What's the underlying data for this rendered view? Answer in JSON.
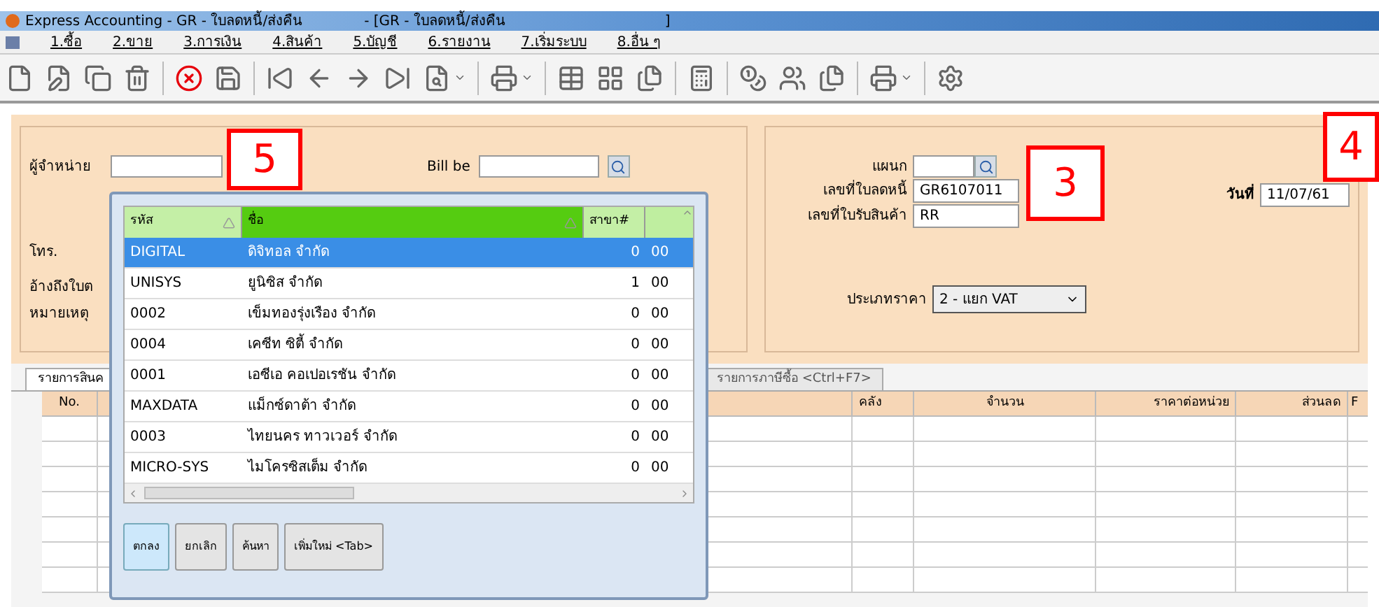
{
  "window": {
    "title": "Express Accounting - GR - ใบลดหนี้/ส่งคืน",
    "subtitle": "- [GR - ใบลดหนี้/ส่งคืน",
    "title_end": "]"
  },
  "menu": [
    "1.ซื้อ",
    "2.ขาย",
    "3.การเงิน",
    "4.สินค้า",
    "5.บัญชี",
    "6.รายงาน",
    "7.เริ่มระบบ",
    "8.อื่น ๆ"
  ],
  "form": {
    "supplier_label": "ผู้จำหน่าย",
    "bill_label": "Bill be",
    "phone_label": "โทร.",
    "reference_label": "อ้างถึงใบต",
    "note_label": "หมายเหตุ",
    "department_label": "แผนก",
    "credit_note_label": "เลขที่ใบลดหนี้",
    "credit_note_value": "GR6107011",
    "receipt_label": "เลขที่ใบรับสินค้า",
    "receipt_value": "RR",
    "date_label": "วันที่",
    "date_value": "11/07/61",
    "price_type_label": "ประเภทราคา",
    "price_type_value": "2 - แยก VAT"
  },
  "tabs": [
    {
      "label": "รายการสินค",
      "selected": true
    },
    {
      "label": "รายการภาษีซื้อ <Ctrl+F7>",
      "selected": false
    }
  ],
  "table": {
    "columns": [
      "No.",
      "คลัง",
      "จำนวน",
      "ราคาต่อหน่วย",
      "ส่วนลด",
      "F"
    ]
  },
  "supplier_popup": {
    "columns": [
      {
        "label": "รหัส",
        "sorted": false
      },
      {
        "label": "ชื่อ",
        "sorted": true
      },
      {
        "label": "สาขา#",
        "sorted": false
      }
    ],
    "rows": [
      {
        "code": "DIGITAL",
        "name": "ดิจิทอล จำกัด",
        "branch": "0",
        "column_4": "00",
        "selected": true
      },
      {
        "code": "UNISYS",
        "name": "ยูนิซิส จำกัด",
        "branch": "1",
        "column_4": "00",
        "selected": false
      },
      {
        "code": "0002",
        "name": "เข็มทองรุ่งเรือง จำกัด",
        "branch": "0",
        "column_4": "00",
        "selected": false
      },
      {
        "code": "0004",
        "name": "เคซีท ซิตี้ จำกัด",
        "branch": "0",
        "column_4": "00",
        "selected": false
      },
      {
        "code": "0001",
        "name": "เอซีเอ คอเปอเรชัน จำกัด",
        "branch": "0",
        "column_4": "00",
        "selected": false
      },
      {
        "code": "MAXDATA",
        "name": "แม็กซ์ดาต้า จำกัด",
        "branch": "0",
        "column_4": "00",
        "selected": false
      },
      {
        "code": "0003",
        "name": "ไทยนคร ทาวเวอร์ จำกัด",
        "branch": "0",
        "column_4": "00",
        "selected": false
      },
      {
        "code": "MICRO-SYS",
        "name": "ไมโครซิสเต็ม จำกัด",
        "branch": "0",
        "column_4": "00",
        "selected": false
      }
    ],
    "buttons": [
      {
        "label": "ตกลง",
        "selected": true
      },
      {
        "label": "ยกเลิก",
        "selected": false
      },
      {
        "label": "ค้นหา",
        "selected": false
      },
      {
        "label": "เพิ่มใหม่ <Tab>",
        "selected": false
      }
    ]
  },
  "callouts": [
    "5",
    "3",
    "4"
  ]
}
